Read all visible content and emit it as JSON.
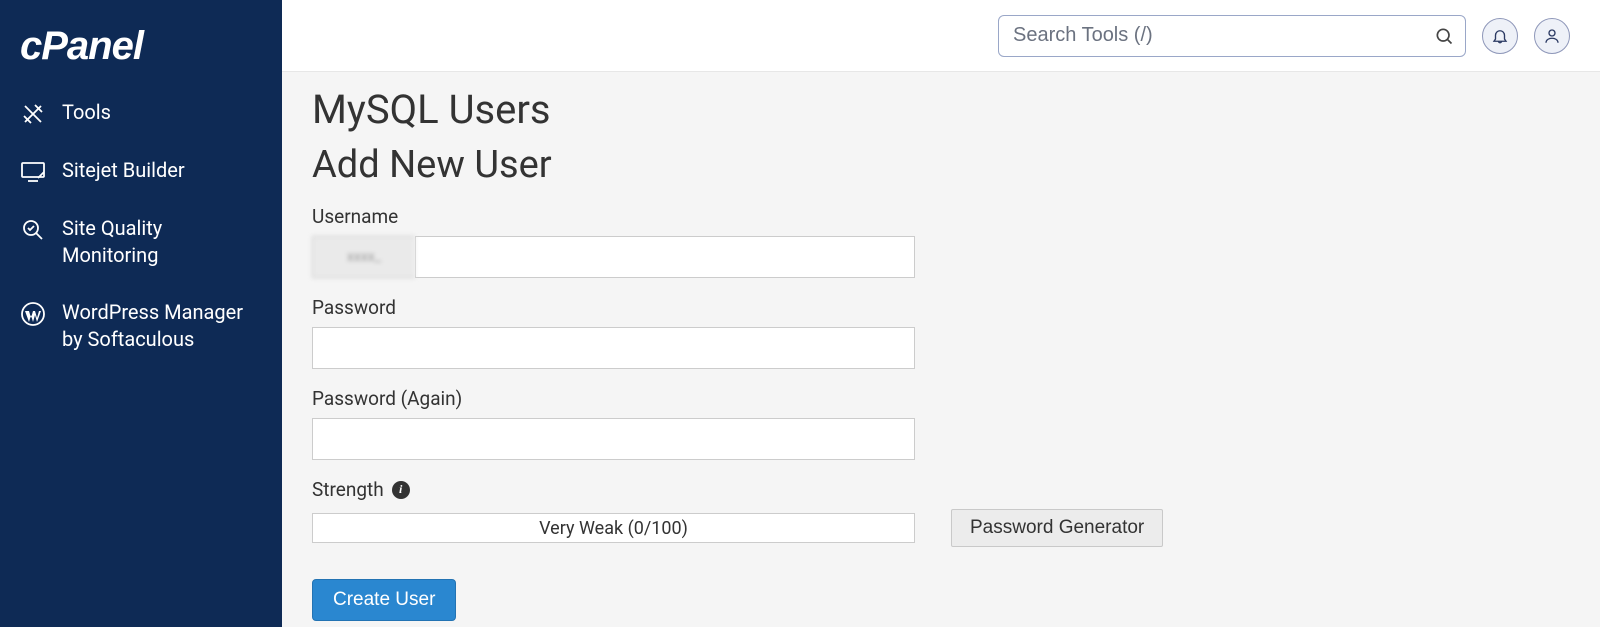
{
  "brand": {
    "name": "cPanel"
  },
  "sidebar": {
    "items": [
      {
        "label": "Tools",
        "icon": "tools-icon"
      },
      {
        "label": "Sitejet Builder",
        "icon": "monitor-icon"
      },
      {
        "label": "Site Quality Monitoring",
        "icon": "magnifier-check-icon"
      },
      {
        "label": "WordPress Manager by Softaculous",
        "icon": "wordpress-icon"
      }
    ]
  },
  "topbar": {
    "search_placeholder": "Search Tools (/)"
  },
  "page": {
    "title": "MySQL Users",
    "section_title": "Add New User",
    "form": {
      "username_label": "Username",
      "username_prefix": "xxxx_",
      "username_value": "",
      "password_label": "Password",
      "password_value": "",
      "password_again_label": "Password (Again)",
      "password_again_value": "",
      "strength_label": "Strength",
      "strength_text": "Very Weak (0/100)",
      "strength_value": 0,
      "strength_max": 100,
      "password_generator_label": "Password Generator",
      "submit_label": "Create User"
    }
  }
}
